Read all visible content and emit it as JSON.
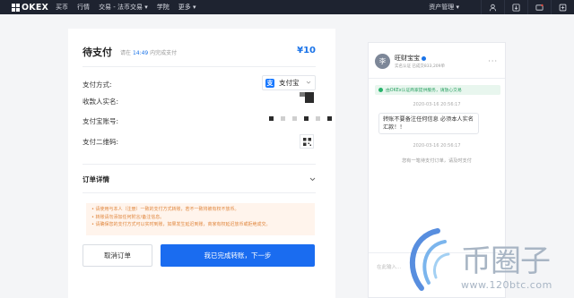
{
  "topbar": {
    "logo_text": "OKEX",
    "nav": [
      "买币",
      "行情",
      "交易 - 法币交易",
      "学院",
      "更多"
    ],
    "asset_label": "资产管理",
    "icons": [
      "user-icon",
      "download-icon",
      "message-icon",
      "globe-icon"
    ]
  },
  "payment": {
    "title": "待支付",
    "hint_prefix": "请在",
    "hint_time": "14:49",
    "hint_suffix": "内完成支付",
    "amount": "¥10",
    "method_label": "支付方式:",
    "method_value": "支付宝",
    "method_icon": "支",
    "payee_label": "收款人实名:",
    "account_label": "支付宝账号:",
    "qr_label": "支付二维码:",
    "order_detail_label": "订单详情",
    "notices": [
      "• 请使用与本人（注册）一致的支付方式转账，若不一致将被有权不放币。",
      "• 转账请勿添加任何附言/备注信息。",
      "• 请确保您的支付方式可以实时到账，如果发生延迟到账，商家有权延迟放币或拒绝成交。"
    ],
    "cancel_button": "取消订单",
    "done_button": "我已完成转账，下一步"
  },
  "chat": {
    "avatar_letter": "李",
    "name": "旺财宝宝",
    "meta": "实名认证   已成交833,209单",
    "more": "···",
    "safe_notice": "由OKEx认证商家提供服务，请放心交易",
    "timestamp1": "2020-03-16 20:56:17",
    "message": "转账不要备注任何信息 必须本人实名汇款！！",
    "timestamp2": "2020-03-16 20:56:17",
    "system_message": "您有一笔待支付订单，请及时支付",
    "input_placeholder": "在此输入..."
  },
  "watermark": {
    "text": "币圈子",
    "url": "www.120btc.com"
  },
  "colors": {
    "topbar_bg": "#1e2330",
    "accent_blue": "#1a6cf0",
    "notice_orange": "#e0863d",
    "safe_green": "#27a060"
  }
}
